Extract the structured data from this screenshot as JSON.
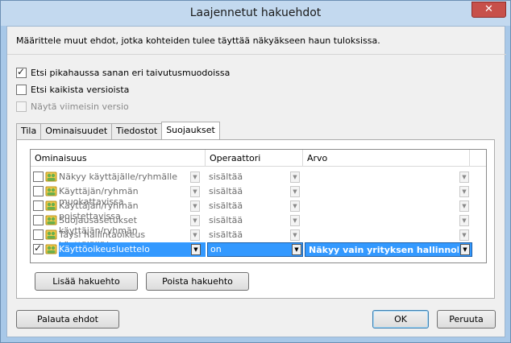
{
  "window": {
    "title": "Laajennetut hakuehdot",
    "close_glyph": "✕"
  },
  "description": "Määrittele muut ehdot, jotka kohteiden tulee täyttää näkyäkseen haun tuloksissa.",
  "options": [
    {
      "label": "Etsi pikahaussa sanan eri taivutusmuodoissa",
      "checked": true,
      "enabled": true
    },
    {
      "label": "Etsi kaikista versioista",
      "checked": false,
      "enabled": true
    },
    {
      "label": "Näytä viimeisin versio",
      "checked": false,
      "enabled": false
    }
  ],
  "tabs": [
    {
      "label": "Tila",
      "active": false
    },
    {
      "label": "Ominaisuudet",
      "active": false
    },
    {
      "label": "Tiedostot",
      "active": false
    },
    {
      "label": "Suojaukset",
      "active": true
    }
  ],
  "grid": {
    "headers": {
      "property": "Ominaisuus",
      "operator": "Operaattori",
      "value": "Arvo"
    },
    "rows": [
      {
        "checked": false,
        "property": "Näkyy käyttäjälle/ryhmälle",
        "operator": "sisältää",
        "value": "",
        "selected": false
      },
      {
        "checked": false,
        "property": "Käyttäjän/ryhmän muokattavissa",
        "operator": "sisältää",
        "value": "",
        "selected": false
      },
      {
        "checked": false,
        "property": "Käyttäjän/ryhmän poistettavissa",
        "operator": "sisältää",
        "value": "",
        "selected": false
      },
      {
        "checked": false,
        "property": "Suojausasetukset käyttäjän/ryhmän",
        "operator": "sisältää",
        "value": "",
        "selected": false
      },
      {
        "checked": false,
        "property": "Täysi hallintaoikeus käyttäjällä/ry",
        "operator": "sisältää",
        "value": "",
        "selected": false
      },
      {
        "checked": true,
        "property": "Käyttöoikeusluettelo",
        "operator": "on",
        "value": "Näkyy vain yrityksen hallinnolle ja",
        "selected": true
      }
    ]
  },
  "buttons": {
    "add_condition": "Lisää hakuehto",
    "remove_condition": "Poista hakuehto",
    "restore": "Palauta ehdot",
    "ok": "OK",
    "cancel": "Peruuta"
  },
  "colors": {
    "selection": "#3399ff",
    "icon_green": "#6ab04c",
    "icon_yellow": "#f2c94c"
  },
  "icons": {
    "row_icon": "user-group-icon",
    "dropdown": "chevron-down-icon"
  }
}
